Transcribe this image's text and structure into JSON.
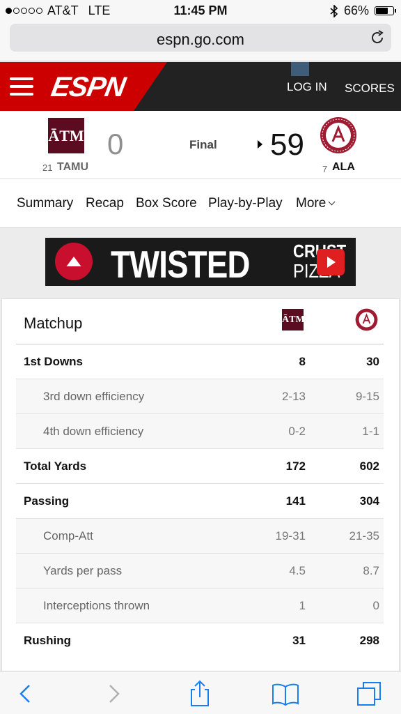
{
  "status_bar": {
    "carrier": "AT&T",
    "network": "LTE",
    "time": "11:45 PM",
    "battery": "66%",
    "battery_level": 0.66
  },
  "browser": {
    "url": "espn.go.com"
  },
  "header": {
    "logo": "ESPN",
    "login": "LOG IN",
    "scores": "SCORES",
    "colors": {
      "brand_red": "#cc0000",
      "dark": "#222222"
    }
  },
  "game": {
    "away": {
      "logo_text": "ĀTM",
      "score": "0",
      "rank": "21",
      "abbr": "TAMU",
      "color": "#5b0c21"
    },
    "status": "Final",
    "home": {
      "score": "59",
      "rank": "7",
      "abbr": "ALA",
      "color": "#9e1b32"
    }
  },
  "tabs": [
    "Summary",
    "Recap",
    "Box Score",
    "Play-by-Play",
    "More"
  ],
  "ad": {
    "headline": "TWISTED",
    "line1": "CRUST",
    "line2": "PIZZA"
  },
  "matchup": {
    "title": "Matchup",
    "rows": [
      {
        "label": "1st Downs",
        "away": "8",
        "home": "30",
        "kind": "main"
      },
      {
        "label": "3rd down efficiency",
        "away": "2-13",
        "home": "9-15",
        "kind": "sub"
      },
      {
        "label": "4th down efficiency",
        "away": "0-2",
        "home": "1-1",
        "kind": "sub"
      },
      {
        "label": "Total Yards",
        "away": "172",
        "home": "602",
        "kind": "main"
      },
      {
        "label": "Passing",
        "away": "141",
        "home": "304",
        "kind": "main"
      },
      {
        "label": "Comp-Att",
        "away": "19-31",
        "home": "21-35",
        "kind": "sub"
      },
      {
        "label": "Yards per pass",
        "away": "4.5",
        "home": "8.7",
        "kind": "sub"
      },
      {
        "label": "Interceptions thrown",
        "away": "1",
        "home": "0",
        "kind": "sub"
      },
      {
        "label": "Rushing",
        "away": "31",
        "home": "298",
        "kind": "main"
      }
    ]
  },
  "toolbar": {
    "icons": [
      "back-icon",
      "forward-icon",
      "share-icon",
      "bookmarks-icon",
      "tabs-icon"
    ]
  }
}
